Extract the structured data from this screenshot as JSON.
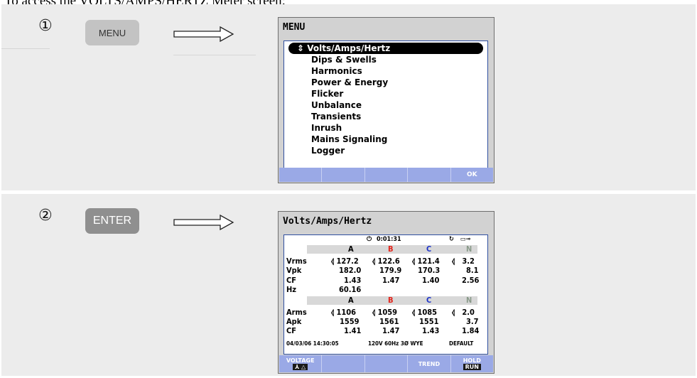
{
  "heading": "To access the VOLTS/AMPS/HERTZ Meter screen:",
  "steps": [
    {
      "number": "①",
      "key": "MENU"
    },
    {
      "number": "②",
      "key": "ENTER"
    }
  ],
  "menu_screen": {
    "title": "MENU",
    "items": [
      "Volts/Amps/Hertz",
      "Dips & Swells",
      "Harmonics",
      "Power & Energy",
      "Flicker",
      "Unbalance",
      "Transients",
      "Inrush",
      "Mains Signaling",
      "Logger"
    ],
    "selected_index": 0,
    "softkeys": [
      "",
      "",
      "",
      "",
      "OK"
    ]
  },
  "meter_screen": {
    "title": "Volts/Amps/Hertz",
    "timer": "0:01:31",
    "channels": [
      "A",
      "B",
      "C",
      "N"
    ],
    "rows_v": [
      {
        "label": "Vrms",
        "values": [
          "127.2",
          "122.6",
          "121.4",
          "3.2"
        ]
      },
      {
        "label": "Vpk",
        "values": [
          "182.0",
          "179.9",
          "170.3",
          "8.1"
        ]
      },
      {
        "label": "CF",
        "values": [
          "1.43",
          "1.47",
          "1.40",
          "2.56"
        ]
      },
      {
        "label": "Hz",
        "values": [
          "60.16",
          "",
          "",
          ""
        ]
      }
    ],
    "rows_a": [
      {
        "label": "Arms",
        "values": [
          "1106",
          "1059",
          "1085",
          "2.0"
        ]
      },
      {
        "label": "Apk",
        "values": [
          "1559",
          "1561",
          "1551",
          "3.7"
        ]
      },
      {
        "label": "CF",
        "values": [
          "1.41",
          "1.47",
          "1.43",
          "1.84"
        ]
      }
    ],
    "status": {
      "datetime": "04/03/06 14:30:05",
      "config": "120V 60Hz 3Ø WYE",
      "mode": "DEFAULT"
    },
    "softkeys": [
      {
        "top": "VOLTAGE",
        "bottom": "⅄ △"
      },
      {
        "top": "",
        "bottom": ""
      },
      {
        "top": "",
        "bottom": ""
      },
      {
        "top": "TREND",
        "bottom": ""
      },
      {
        "top": "HOLD",
        "bottom": "RUN"
      }
    ]
  },
  "colors": {
    "phase_b": "#e2231a",
    "phase_c": "#1d33c7",
    "neutral": "#8a9a8a",
    "softbar": "#9aa9e6"
  }
}
